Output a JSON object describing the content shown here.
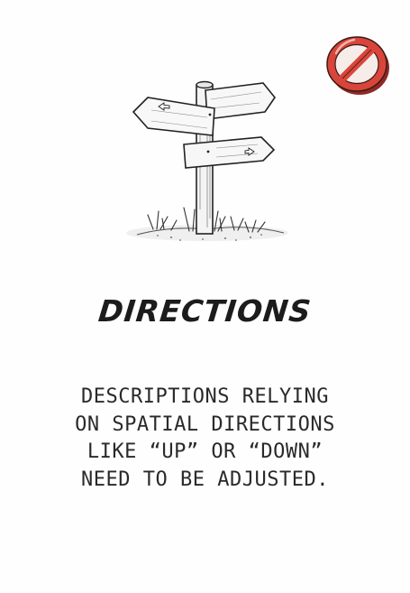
{
  "card": {
    "title": "DIRECTIONS",
    "description_lines": [
      "DESCRIPTIONS RELYING",
      "ON SPATIAL DIRECTIONS",
      "LIKE “UP” OR “DOWN”",
      "NEED TO BE ADJUSTED."
    ],
    "icons": {
      "badge": "prohibited-icon",
      "illustration": "signpost-icon"
    },
    "colors": {
      "badge_red": "#d9453a",
      "badge_rim": "#b5362d",
      "text": "#1c1c1c"
    }
  }
}
